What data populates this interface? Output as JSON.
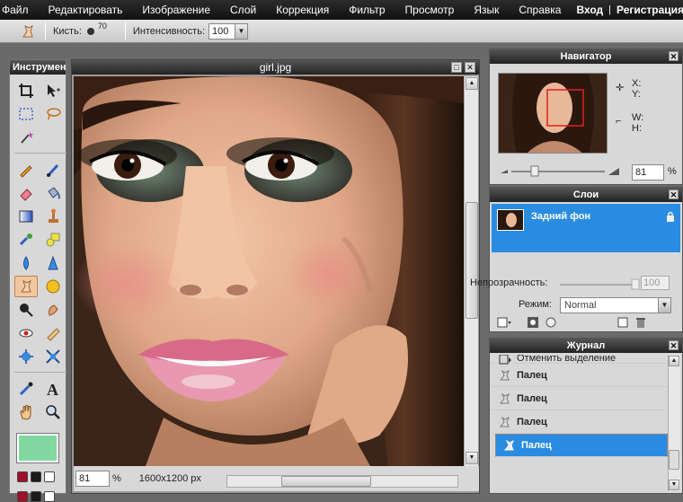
{
  "menubar": {
    "items": [
      "Файл",
      "Редактировать",
      "Изображение",
      "Слой",
      "Коррекция",
      "Фильтр",
      "Просмотр",
      "Язык",
      "Справка"
    ],
    "login": "Вход",
    "separator": "|",
    "register": "Регистрация"
  },
  "optbar": {
    "brush_label": "Кисть:",
    "brush_size": "70",
    "intensity_label": "Интенсивность:",
    "intensity_value": "100"
  },
  "tools": {
    "title": "Инструменты",
    "foreground_color": "#80d8a0"
  },
  "document": {
    "title": "girl.jpg",
    "zoom": "81",
    "zoom_unit": "%",
    "dimensions": "1600x1200 px"
  },
  "navigator": {
    "title": "Навигатор",
    "x_label": "X:",
    "y_label": "Y:",
    "w_label": "W:",
    "h_label": "H:",
    "zoom": "81",
    "zoom_unit": "%"
  },
  "layers": {
    "title": "Слои",
    "layer_name": "Задний фон",
    "opacity_label": "Непрозрачность:",
    "opacity_value": "100",
    "mode_label": "Режим:",
    "mode_value": "Normal"
  },
  "journal": {
    "title": "Журнал",
    "items": [
      "Отменить выделение",
      "Палец",
      "Палец",
      "Палец",
      "Палец"
    ]
  },
  "colors": {
    "accent": "#2a8ce0",
    "titlebar": "#2c2c2c"
  }
}
